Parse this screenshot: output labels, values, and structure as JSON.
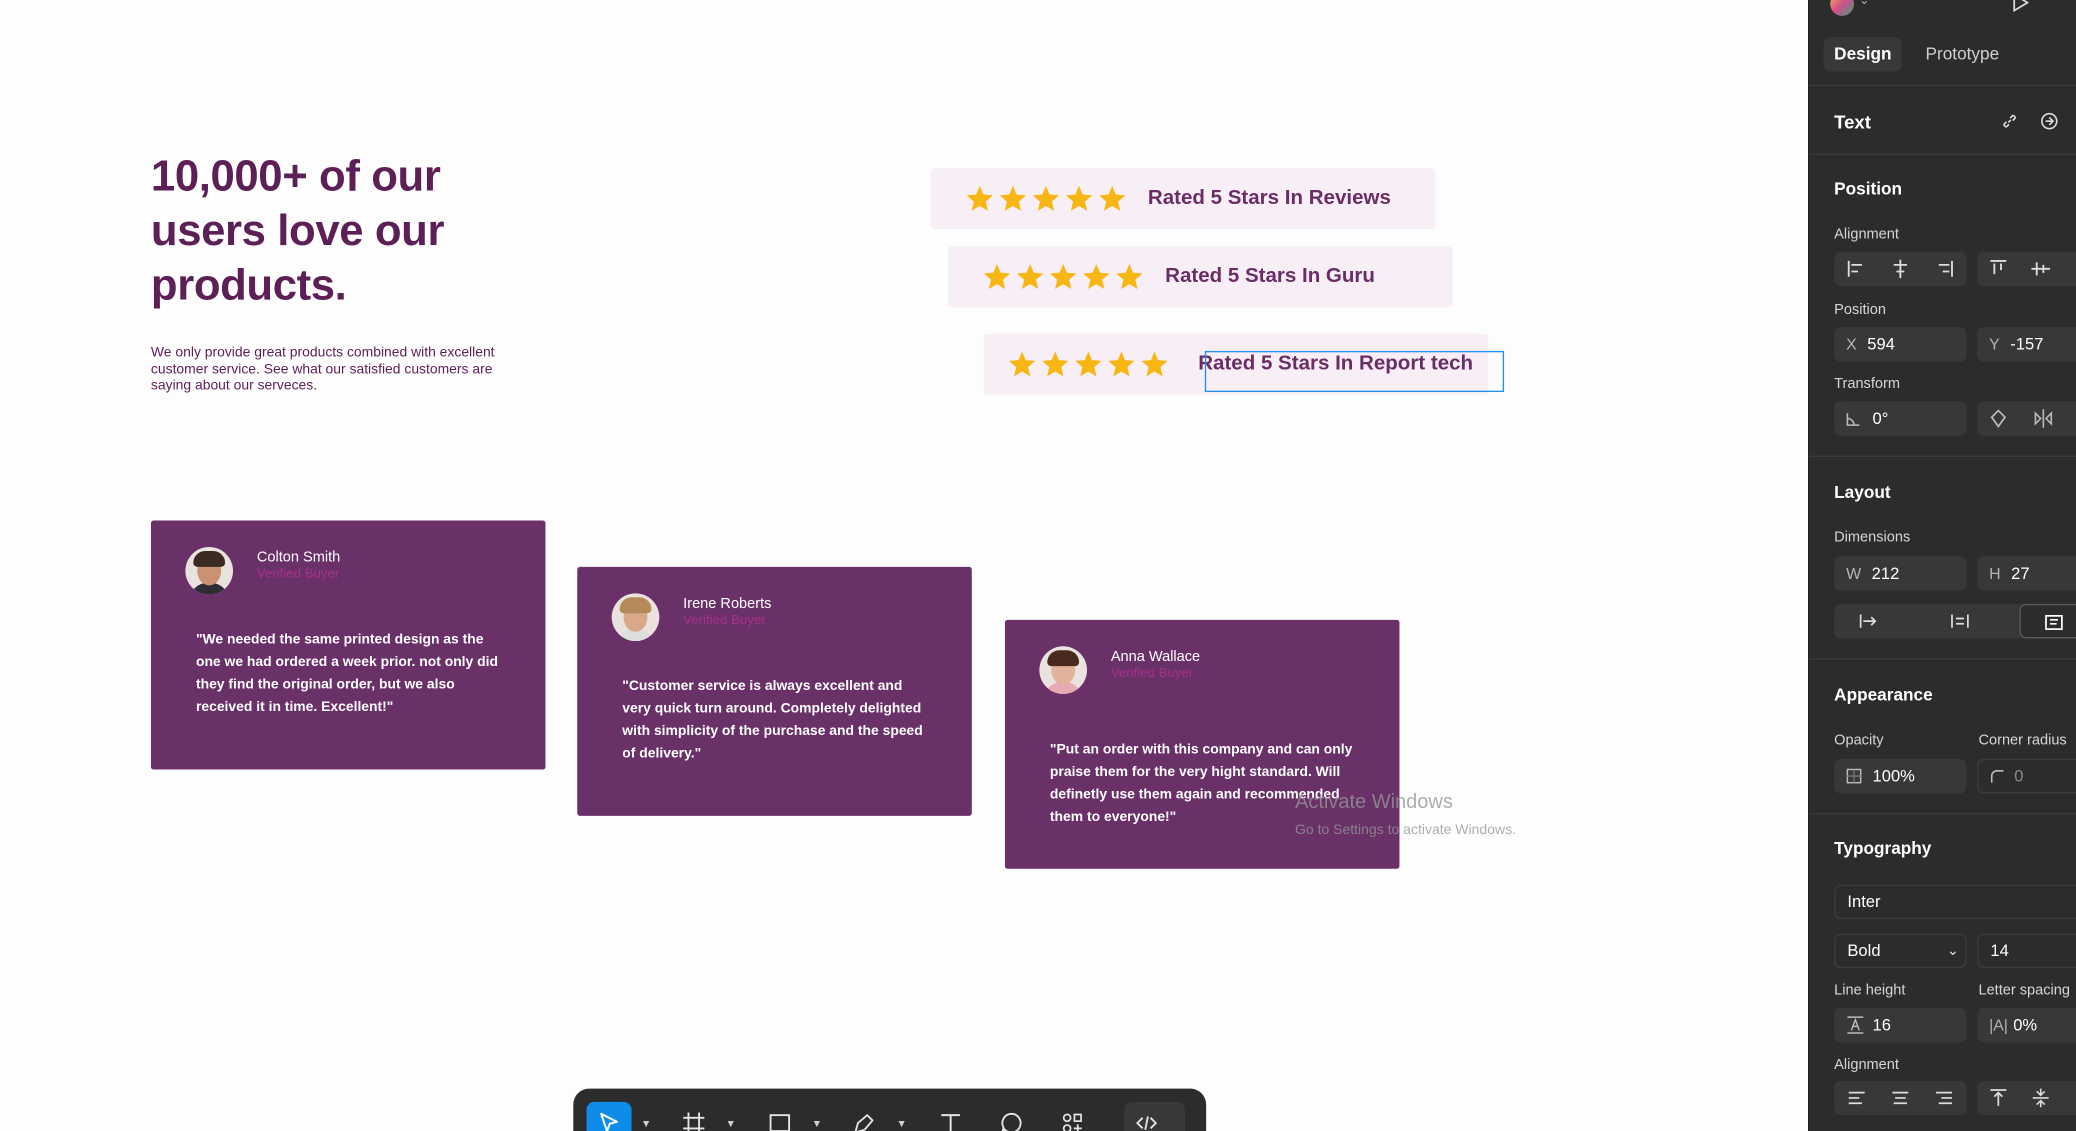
{
  "canvas": {
    "headline": "10,000+ of our users love our products.",
    "subtext": "We only provide great products combined with excellent customer service. See what our satisfied customers are  saying about our serveces.",
    "ratings": [
      {
        "label": "Rated 5 Stars In Reviews",
        "stars": 5
      },
      {
        "label": "Rated 5 Stars In Guru",
        "stars": 5
      },
      {
        "label": "Rated 5 Stars In Report tech",
        "stars": 5
      }
    ],
    "testimonials": [
      {
        "name": "Colton Smith",
        "role": "Verified Buyer",
        "quote": "\"We needed the same printed design as the one we had ordered a week prior. not only did they find the original order, but we also received it in time. Excellent!\""
      },
      {
        "name": "Irene Roberts",
        "role": "Verified Buyer",
        "quote": "\"Customer service is always excellent and very quick turn around. Completely delighted with simplicity of the purchase and the speed of delivery.\""
      },
      {
        "name": "Anna Wallace",
        "role": "Verified Buyer",
        "quote": "\"Put an order with this company and can only praise them for the very hight standard. Will definetly use them again and recommended them to everyone!\""
      }
    ],
    "colors": {
      "brand": "#5c1f56",
      "card": "#6a3068",
      "star": "#f7b614",
      "selection": "#1e8ff5"
    }
  },
  "toolbar": {
    "tools": [
      "move-icon",
      "frame-icon",
      "rectangle-icon",
      "pen-icon",
      "text-icon",
      "comment-icon",
      "components-icon",
      "dev-mode-icon"
    ],
    "active_tool": "move-icon"
  },
  "watermark": {
    "line1": "Activate Windows",
    "line2": "Go to Settings to activate Windows."
  },
  "panel": {
    "tabs": {
      "design": "Design",
      "prototype": "Prototype"
    },
    "layer_type": "Text",
    "position": {
      "title": "Position",
      "alignment_label": "Alignment",
      "position_label": "Position",
      "x_prefix": "X",
      "x_value": "594",
      "y_prefix": "Y",
      "y_value": "-157",
      "transform_label": "Transform",
      "rotation": "0°"
    },
    "layout": {
      "title": "Layout",
      "dimensions_label": "Dimensions",
      "w_prefix": "W",
      "w_value": "212",
      "h_prefix": "H",
      "h_value": "27"
    },
    "appearance": {
      "title": "Appearance",
      "opacity_label": "Opacity",
      "opacity_value": "100%",
      "radius_label": "Corner radius",
      "radius_value": "0"
    },
    "typography": {
      "title": "Typography",
      "font_family": "Inter",
      "font_weight": "Bold",
      "font_size": "14",
      "line_height_label": "Line height",
      "line_height_value": "16",
      "letter_spacing_label": "Letter spacing",
      "letter_spacing_value": "0%",
      "alignment_label": "Alignment"
    }
  }
}
